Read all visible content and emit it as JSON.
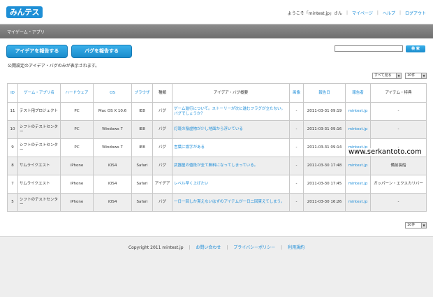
{
  "header": {
    "logo_text": "みんテス",
    "greeting": "ようこそ「mintest.jp」さん",
    "links": [
      "マイページ",
      "ヘルプ",
      "ログアウト"
    ]
  },
  "navbar": {
    "label": "マイゲーム・アプリ"
  },
  "actions": {
    "report_idea": "アイデアを報告する",
    "report_bug": "バグを報告する",
    "search_button": "検 索",
    "search_value": ""
  },
  "notice": "公開設定のアイデア・バグのみが表示されます。",
  "filters": {
    "type_selected": "すべて見る",
    "per_page_selected": "10件",
    "per_page_bottom": "10件"
  },
  "table": {
    "headers": [
      "ID",
      "ゲーム・アプリ名",
      "ハードウェア",
      "OS",
      "ブラウザ",
      "種類",
      "アイデア・バグ概要",
      "画像",
      "報告日",
      "報告者",
      "アイテム・特典"
    ],
    "rows": [
      [
        "11",
        "テスト用プロジェクト",
        "PC",
        "Mac OS X 10.6",
        "IE8",
        "バグ",
        "ゲーム進行について。ストーリーが次に進むフラグが立たない。バグでしょうか？",
        "-",
        "2011-03-31 09:19",
        "mintest.jp",
        "-"
      ],
      [
        "10",
        "シフトのテストセンター",
        "PC",
        "Windows 7",
        "IE8",
        "バグ",
        "灯篭の陰虚物が少し地面から浮いている",
        "-",
        "2011-03-31 09:16",
        "mintest.jp",
        "-"
      ],
      [
        "9",
        "シフトのテストセンター",
        "PC",
        "Windows 7",
        "IE8",
        "バグ",
        "言葉に誤字がある",
        "-",
        "2011-03-31 09:14",
        "mintest.jp",
        "-"
      ],
      [
        "8",
        "サムライクエスト",
        "iPhone",
        "iOS4",
        "Safari",
        "バグ",
        "武器屋の値段が全て無料になってしまっている。",
        "-",
        "2011-03-30 17:48",
        "mintest.jp",
        "備前長船"
      ],
      [
        "7",
        "サムライクエスト",
        "iPhone",
        "iOS4",
        "Safari",
        "アイデア",
        "レベル早く上げたい",
        "-",
        "2011-03-30 17:45",
        "mintest.jp",
        "ガッパーン・エクスカリバー"
      ],
      [
        "5",
        "シフトのテストセンター",
        "iPhone",
        "iOS4",
        "Safari",
        "バグ",
        "一日一回しか貰えないはずのアイテムが一日二回貰えてしまう。",
        "-",
        "2011-03-30 16:26",
        "mintest.jp",
        "-"
      ]
    ]
  },
  "watermark": "www.serkantoto.com",
  "footer": {
    "copyright": "Copyright 2011 mintest.jp",
    "links": [
      "お問い合わせ",
      "プライバシーポリシー",
      "利用規約"
    ]
  }
}
